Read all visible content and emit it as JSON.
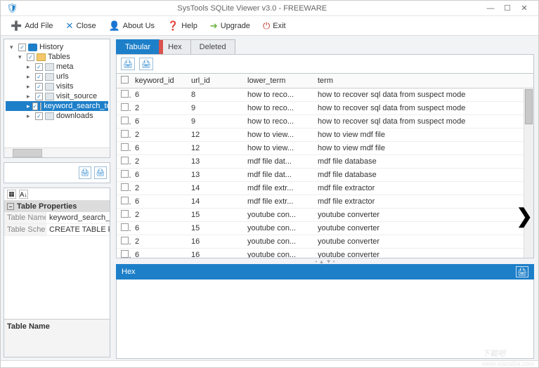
{
  "title": "SysTools SQLite Viewer  v3.0 - FREEWARE",
  "toolbar": {
    "add_file": "Add File",
    "close": "Close",
    "about_us": "About Us",
    "help": "Help",
    "upgrade": "Upgrade",
    "exit": "Exit"
  },
  "tree": [
    {
      "level": 1,
      "expand": "▾",
      "chk": true,
      "icon": "db",
      "label": "History"
    },
    {
      "level": 2,
      "expand": "▾",
      "chk": true,
      "icon": "folder",
      "label": "Tables"
    },
    {
      "level": 3,
      "expand": "▸",
      "chk": true,
      "icon": "table",
      "label": "meta"
    },
    {
      "level": 3,
      "expand": "▸",
      "chk": true,
      "icon": "table",
      "label": "urls"
    },
    {
      "level": 3,
      "expand": "▸",
      "chk": true,
      "icon": "table",
      "label": "visits"
    },
    {
      "level": 3,
      "expand": "▸",
      "chk": true,
      "icon": "table",
      "label": "visit_source"
    },
    {
      "level": 3,
      "expand": "▸",
      "chk": true,
      "icon": "table",
      "label": "keyword_search_terms",
      "selected": true
    },
    {
      "level": 3,
      "expand": "▸",
      "chk": true,
      "icon": "table",
      "label": "downloads"
    }
  ],
  "properties": {
    "category": "Table Properties",
    "rows": [
      {
        "name": "Table Name",
        "value": "keyword_search_terms"
      },
      {
        "name": "Table Schema",
        "value": "CREATE TABLE keyword_search_terms"
      }
    ],
    "desc_title": "Table Name"
  },
  "tabs": {
    "tabular": "Tabular",
    "hex": "Hex",
    "deleted": "Deleted"
  },
  "columns": [
    "keyword_id",
    "url_id",
    "lower_term",
    "term"
  ],
  "rows": [
    {
      "keyword_id": "6",
      "url_id": "8",
      "lower_term": "how to reco...",
      "term": "how to recover sql data from suspect mode"
    },
    {
      "keyword_id": "2",
      "url_id": "9",
      "lower_term": "how to reco...",
      "term": "how to recover sql data from suspect mode"
    },
    {
      "keyword_id": "6",
      "url_id": "9",
      "lower_term": "how to reco...",
      "term": "how to recover sql data from suspect mode"
    },
    {
      "keyword_id": "2",
      "url_id": "12",
      "lower_term": "how to view...",
      "term": "how to view mdf file"
    },
    {
      "keyword_id": "6",
      "url_id": "12",
      "lower_term": "how to view...",
      "term": "how to view mdf file"
    },
    {
      "keyword_id": "2",
      "url_id": "13",
      "lower_term": "mdf file dat...",
      "term": "mdf file database"
    },
    {
      "keyword_id": "6",
      "url_id": "13",
      "lower_term": "mdf file dat...",
      "term": "mdf file database"
    },
    {
      "keyword_id": "2",
      "url_id": "14",
      "lower_term": "mdf file extr...",
      "term": "mdf file extractor"
    },
    {
      "keyword_id": "6",
      "url_id": "14",
      "lower_term": "mdf file extr...",
      "term": "mdf file extractor"
    },
    {
      "keyword_id": "2",
      "url_id": "15",
      "lower_term": "youtube con...",
      "term": "youtube converter"
    },
    {
      "keyword_id": "6",
      "url_id": "15",
      "lower_term": "youtube con...",
      "term": "youtube converter"
    },
    {
      "keyword_id": "2",
      "url_id": "16",
      "lower_term": "youtube con...",
      "term": "youtube converter"
    },
    {
      "keyword_id": "6",
      "url_id": "16",
      "lower_term": "youtube con...",
      "term": "youtube converter"
    }
  ],
  "hex_header": "Hex",
  "watermark": {
    "big": "下载吧",
    "url": "www.xiazaiba.com"
  }
}
